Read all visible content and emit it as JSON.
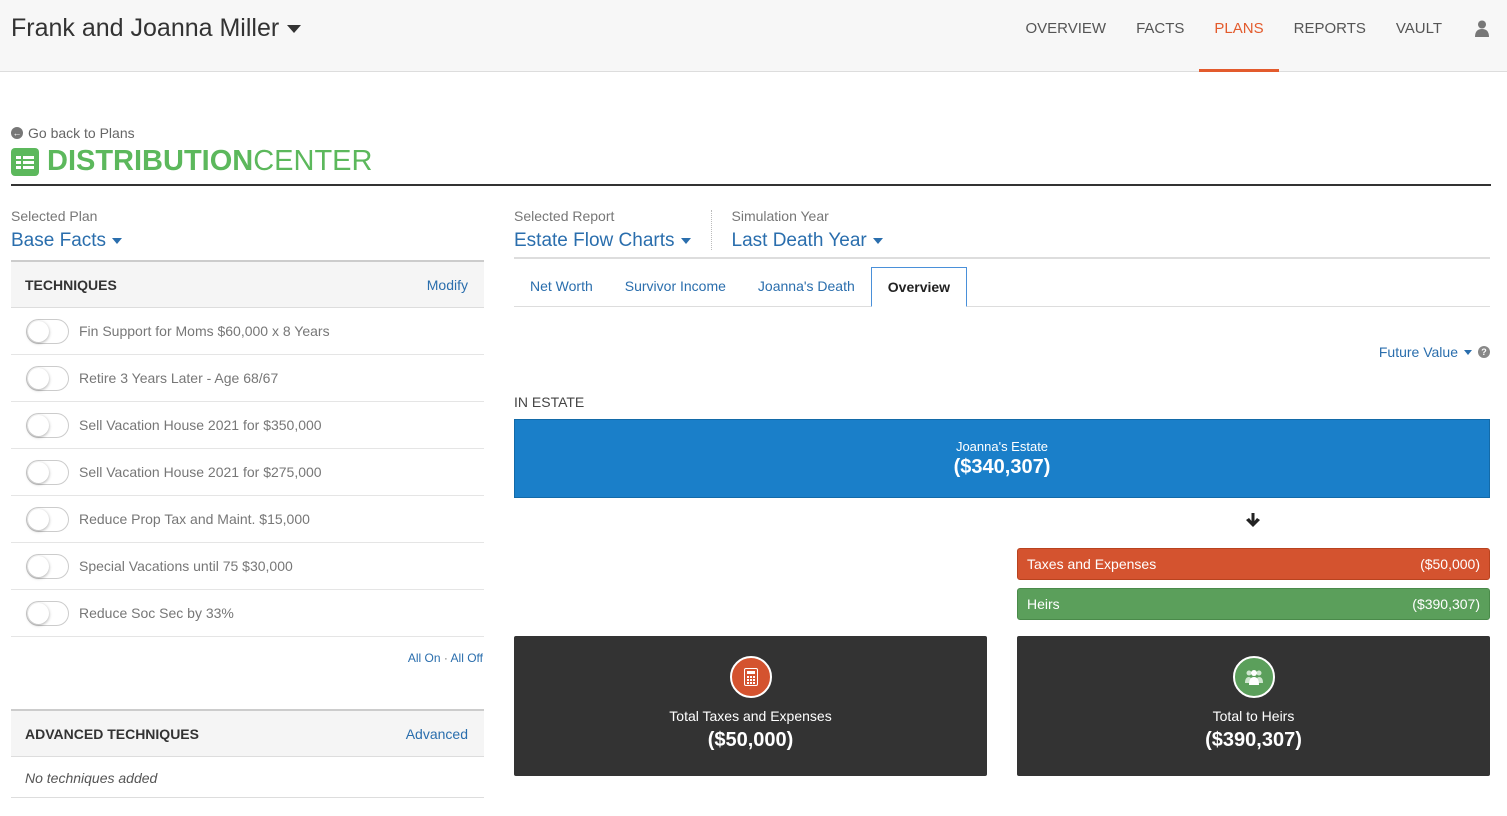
{
  "header": {
    "client_name": "Frank and Joanna Miller",
    "nav": [
      "OVERVIEW",
      "FACTS",
      "PLANS",
      "REPORTS",
      "VAULT"
    ],
    "active_nav": "PLANS",
    "user_icon": "user-icon"
  },
  "page": {
    "back_link": "Go back to Plans",
    "title_bold": "DISTRIBUTION",
    "title_light": "CENTER"
  },
  "left": {
    "selected_plan_label": "Selected Plan",
    "selected_plan": "Base Facts",
    "techniques_title": "TECHNIQUES",
    "modify": "Modify",
    "techniques": [
      {
        "label": "Fin Support for Moms $60,000 x 8 Years",
        "on": false
      },
      {
        "label": "Retire 3 Years Later - Age 68/67",
        "on": false
      },
      {
        "label": "Sell Vacation House 2021 for $350,000",
        "on": false
      },
      {
        "label": "Sell Vacation House 2021 for $275,000",
        "on": false
      },
      {
        "label": "Reduce Prop Tax and Maint. $15,000",
        "on": false
      },
      {
        "label": "Special Vacations until 75 $30,000",
        "on": false
      },
      {
        "label": "Reduce Soc Sec by 33%",
        "on": false
      }
    ],
    "all_on": "All On",
    "separator": "·",
    "all_off": "All Off",
    "advanced_title": "ADVANCED TECHNIQUES",
    "advanced_link": "Advanced",
    "advanced_empty": "No techniques added"
  },
  "right": {
    "selected_report_label": "Selected Report",
    "selected_report": "Estate Flow Charts",
    "simulation_year_label": "Simulation Year",
    "simulation_year": "Last Death Year",
    "tabs": [
      "Net Worth",
      "Survivor Income",
      "Joanna's Death",
      "Overview"
    ],
    "active_tab": "Overview",
    "value_mode": "Future Value",
    "section": "IN ESTATE",
    "estate": {
      "name": "Joanna's Estate",
      "value": "($340,307)"
    },
    "taxes_bar": {
      "label": "Taxes and Expenses",
      "value": "($50,000)"
    },
    "heirs_bar": {
      "label": "Heirs",
      "value": "($390,307)"
    },
    "total_taxes": {
      "label": "Total Taxes and Expenses",
      "value": "($50,000)"
    },
    "total_heirs": {
      "label": "Total to Heirs",
      "value": "($390,307)"
    }
  },
  "colors": {
    "accent": "#e35b2d",
    "link": "#2a6ead",
    "brand_green": "#5cb85c",
    "estate_blue": "#1a7fc9",
    "tax_red": "#d4532f",
    "heirs_green": "#5b9f5b",
    "card_dark": "#333333"
  }
}
